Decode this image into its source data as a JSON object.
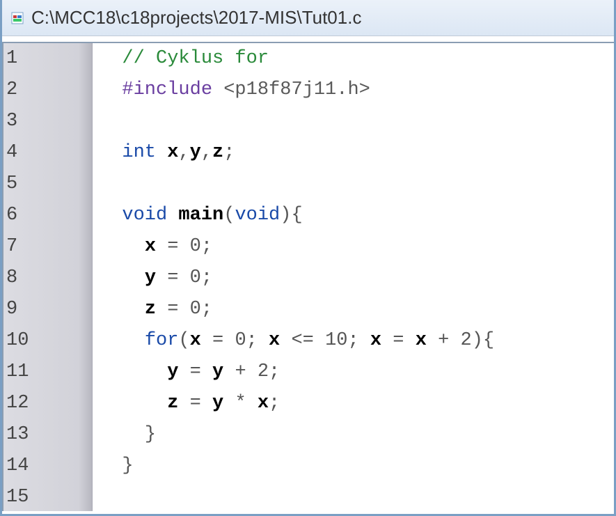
{
  "window": {
    "title": "C:\\MCC18\\c18projects\\2017-MIS\\Tut01.c"
  },
  "gutter": {
    "lines": [
      "1",
      "2",
      "3",
      "4",
      "5",
      "6",
      "7",
      "8",
      "9",
      "10",
      "11",
      "12",
      "13",
      "14",
      "15"
    ]
  },
  "code": {
    "l1": {
      "indent": "  ",
      "comment": "// Cyklus for"
    },
    "l2": {
      "indent": "  ",
      "preproc": "#include",
      "sp": " ",
      "incfile": "<p18f87j11.h>"
    },
    "l3": {
      "blank": ""
    },
    "l4": {
      "indent": "  ",
      "kw": "int",
      "sp": " ",
      "v1": "x",
      "c1": ",",
      "v2": "y",
      "c2": ",",
      "v3": "z",
      "semi": ";"
    },
    "l5": {
      "blank": ""
    },
    "l6": {
      "indent": "  ",
      "kw1": "void",
      "sp1": " ",
      "fn": "main",
      "lp": "(",
      "kw2": "void",
      "rp": ")",
      "lb": "{"
    },
    "l7": {
      "indent": "    ",
      "v": "x",
      "sp1": " ",
      "eq": "=",
      "sp2": " ",
      "n": "0",
      "semi": ";"
    },
    "l8": {
      "indent": "    ",
      "v": "y",
      "sp1": " ",
      "eq": "=",
      "sp2": " ",
      "n": "0",
      "semi": ";"
    },
    "l9": {
      "indent": "    ",
      "v": "z",
      "sp1": " ",
      "eq": "=",
      "sp2": " ",
      "n": "0",
      "semi": ";"
    },
    "l10": {
      "indent": "    ",
      "kw": "for",
      "lp": "(",
      "v1": "x",
      "sp1": " ",
      "eq1": "=",
      "sp2": " ",
      "n1": "0",
      "semi1": ";",
      "sp3": " ",
      "v2": "x",
      "sp4": " ",
      "op": "<=",
      "sp5": " ",
      "n2": "10",
      "semi2": ";",
      "sp6": " ",
      "v3": "x",
      "sp7": " ",
      "eq2": "=",
      "sp8": " ",
      "v4": "x",
      "sp9": " ",
      "plus": "+",
      "sp10": " ",
      "n3": "2",
      "rp": ")",
      "lb": "{"
    },
    "l11": {
      "indent": "      ",
      "v1": "y",
      "sp1": " ",
      "eq": "=",
      "sp2": " ",
      "v2": "y",
      "sp3": " ",
      "op": "+",
      "sp4": " ",
      "n": "2",
      "semi": ";"
    },
    "l12": {
      "indent": "      ",
      "v1": "z",
      "sp1": " ",
      "eq": "=",
      "sp2": " ",
      "v2": "y",
      "sp3": " ",
      "op": "*",
      "sp4": " ",
      "v3": "x",
      "semi": ";"
    },
    "l13": {
      "indent": "    ",
      "rb": "}"
    },
    "l14": {
      "indent": "  ",
      "rb": "}"
    }
  }
}
